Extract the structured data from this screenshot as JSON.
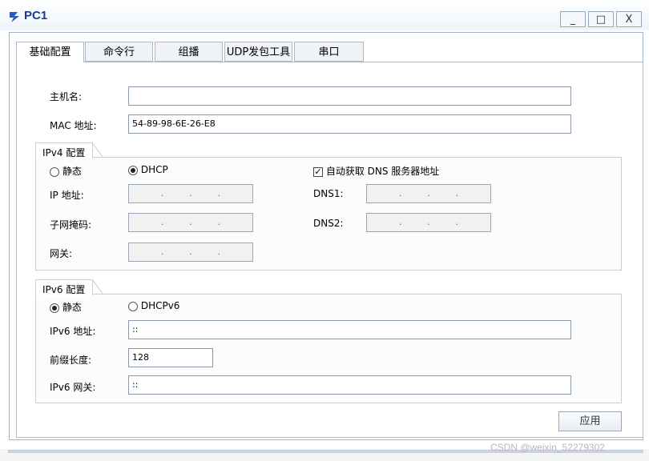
{
  "window": {
    "title": "PC1",
    "minimize_glyph": "_",
    "maximize_glyph": "□",
    "close_glyph": "X"
  },
  "tabs": [
    {
      "label": "基础配置",
      "active": true
    },
    {
      "label": "命令行",
      "active": false
    },
    {
      "label": "组播",
      "active": false
    },
    {
      "label": "UDP发包工具",
      "active": false
    },
    {
      "label": "串口",
      "active": false
    }
  ],
  "basic": {
    "hostname_label": "主机名:",
    "hostname_value": "",
    "mac_label": "MAC 地址:",
    "mac_value": "54-89-98-6E-26-E8"
  },
  "ipv4": {
    "group_title": "IPv4 配置",
    "static_label": "静态",
    "static_selected": false,
    "dhcp_label": "DHCP",
    "dhcp_selected": true,
    "auto_dns_label": "自动获取 DNS 服务器地址",
    "auto_dns_checked": true,
    "ip_label": "IP 地址:",
    "mask_label": "子网掩码:",
    "gateway_label": "网关:",
    "dns1_label": "DNS1:",
    "dns2_label": "DNS2:",
    "ip_dots": ".",
    "check_glyph": "✓"
  },
  "ipv6": {
    "group_title": "IPv6 配置",
    "static_label": "静态",
    "static_selected": true,
    "dhcpv6_label": "DHCPv6",
    "dhcpv6_selected": false,
    "address_label": "IPv6 地址:",
    "address_value": "::",
    "prefix_label": "前缀长度:",
    "prefix_value": "128",
    "gateway_label": "IPv6 网关:",
    "gateway_value": "::"
  },
  "buttons": {
    "apply_label": "应用"
  },
  "watermark": "CSDN @weixin_52279302",
  "colors": {
    "title_text": "#1a3e8c",
    "frame_border": "#9fb2cf",
    "disabled_field": "#f1f1f1"
  }
}
